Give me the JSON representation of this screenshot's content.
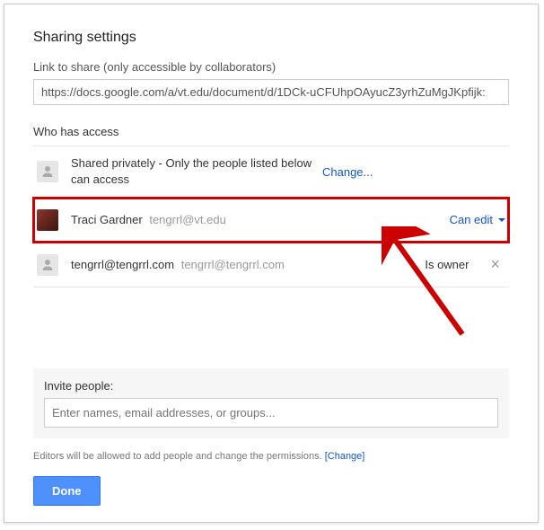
{
  "title": "Sharing settings",
  "linkSection": {
    "label": "Link to share (only accessible by collaborators)",
    "value": "https://docs.google.com/a/vt.edu/document/d/1DCk-uCFUhpOAyucZ3yrhZuMgJKpfijk:"
  },
  "whoLabel": "Who has access",
  "rows": {
    "privacy": {
      "text": "Shared privately - Only the people listed below can access",
      "action": "Change..."
    },
    "user1": {
      "name": "Traci Gardner",
      "email": "tengrrl@vt.edu",
      "permission": "Can edit"
    },
    "user2": {
      "name": "tengrrl@tengrrl.com",
      "email": "tengrrl@tengrrl.com",
      "status": "Is owner"
    }
  },
  "invite": {
    "label": "Invite people:",
    "placeholder": "Enter names, email addresses, or groups..."
  },
  "footer": {
    "note": "Editors will be allowed to add people and change the permissions.  ",
    "changeLabel": "[Change]"
  },
  "doneLabel": "Done"
}
